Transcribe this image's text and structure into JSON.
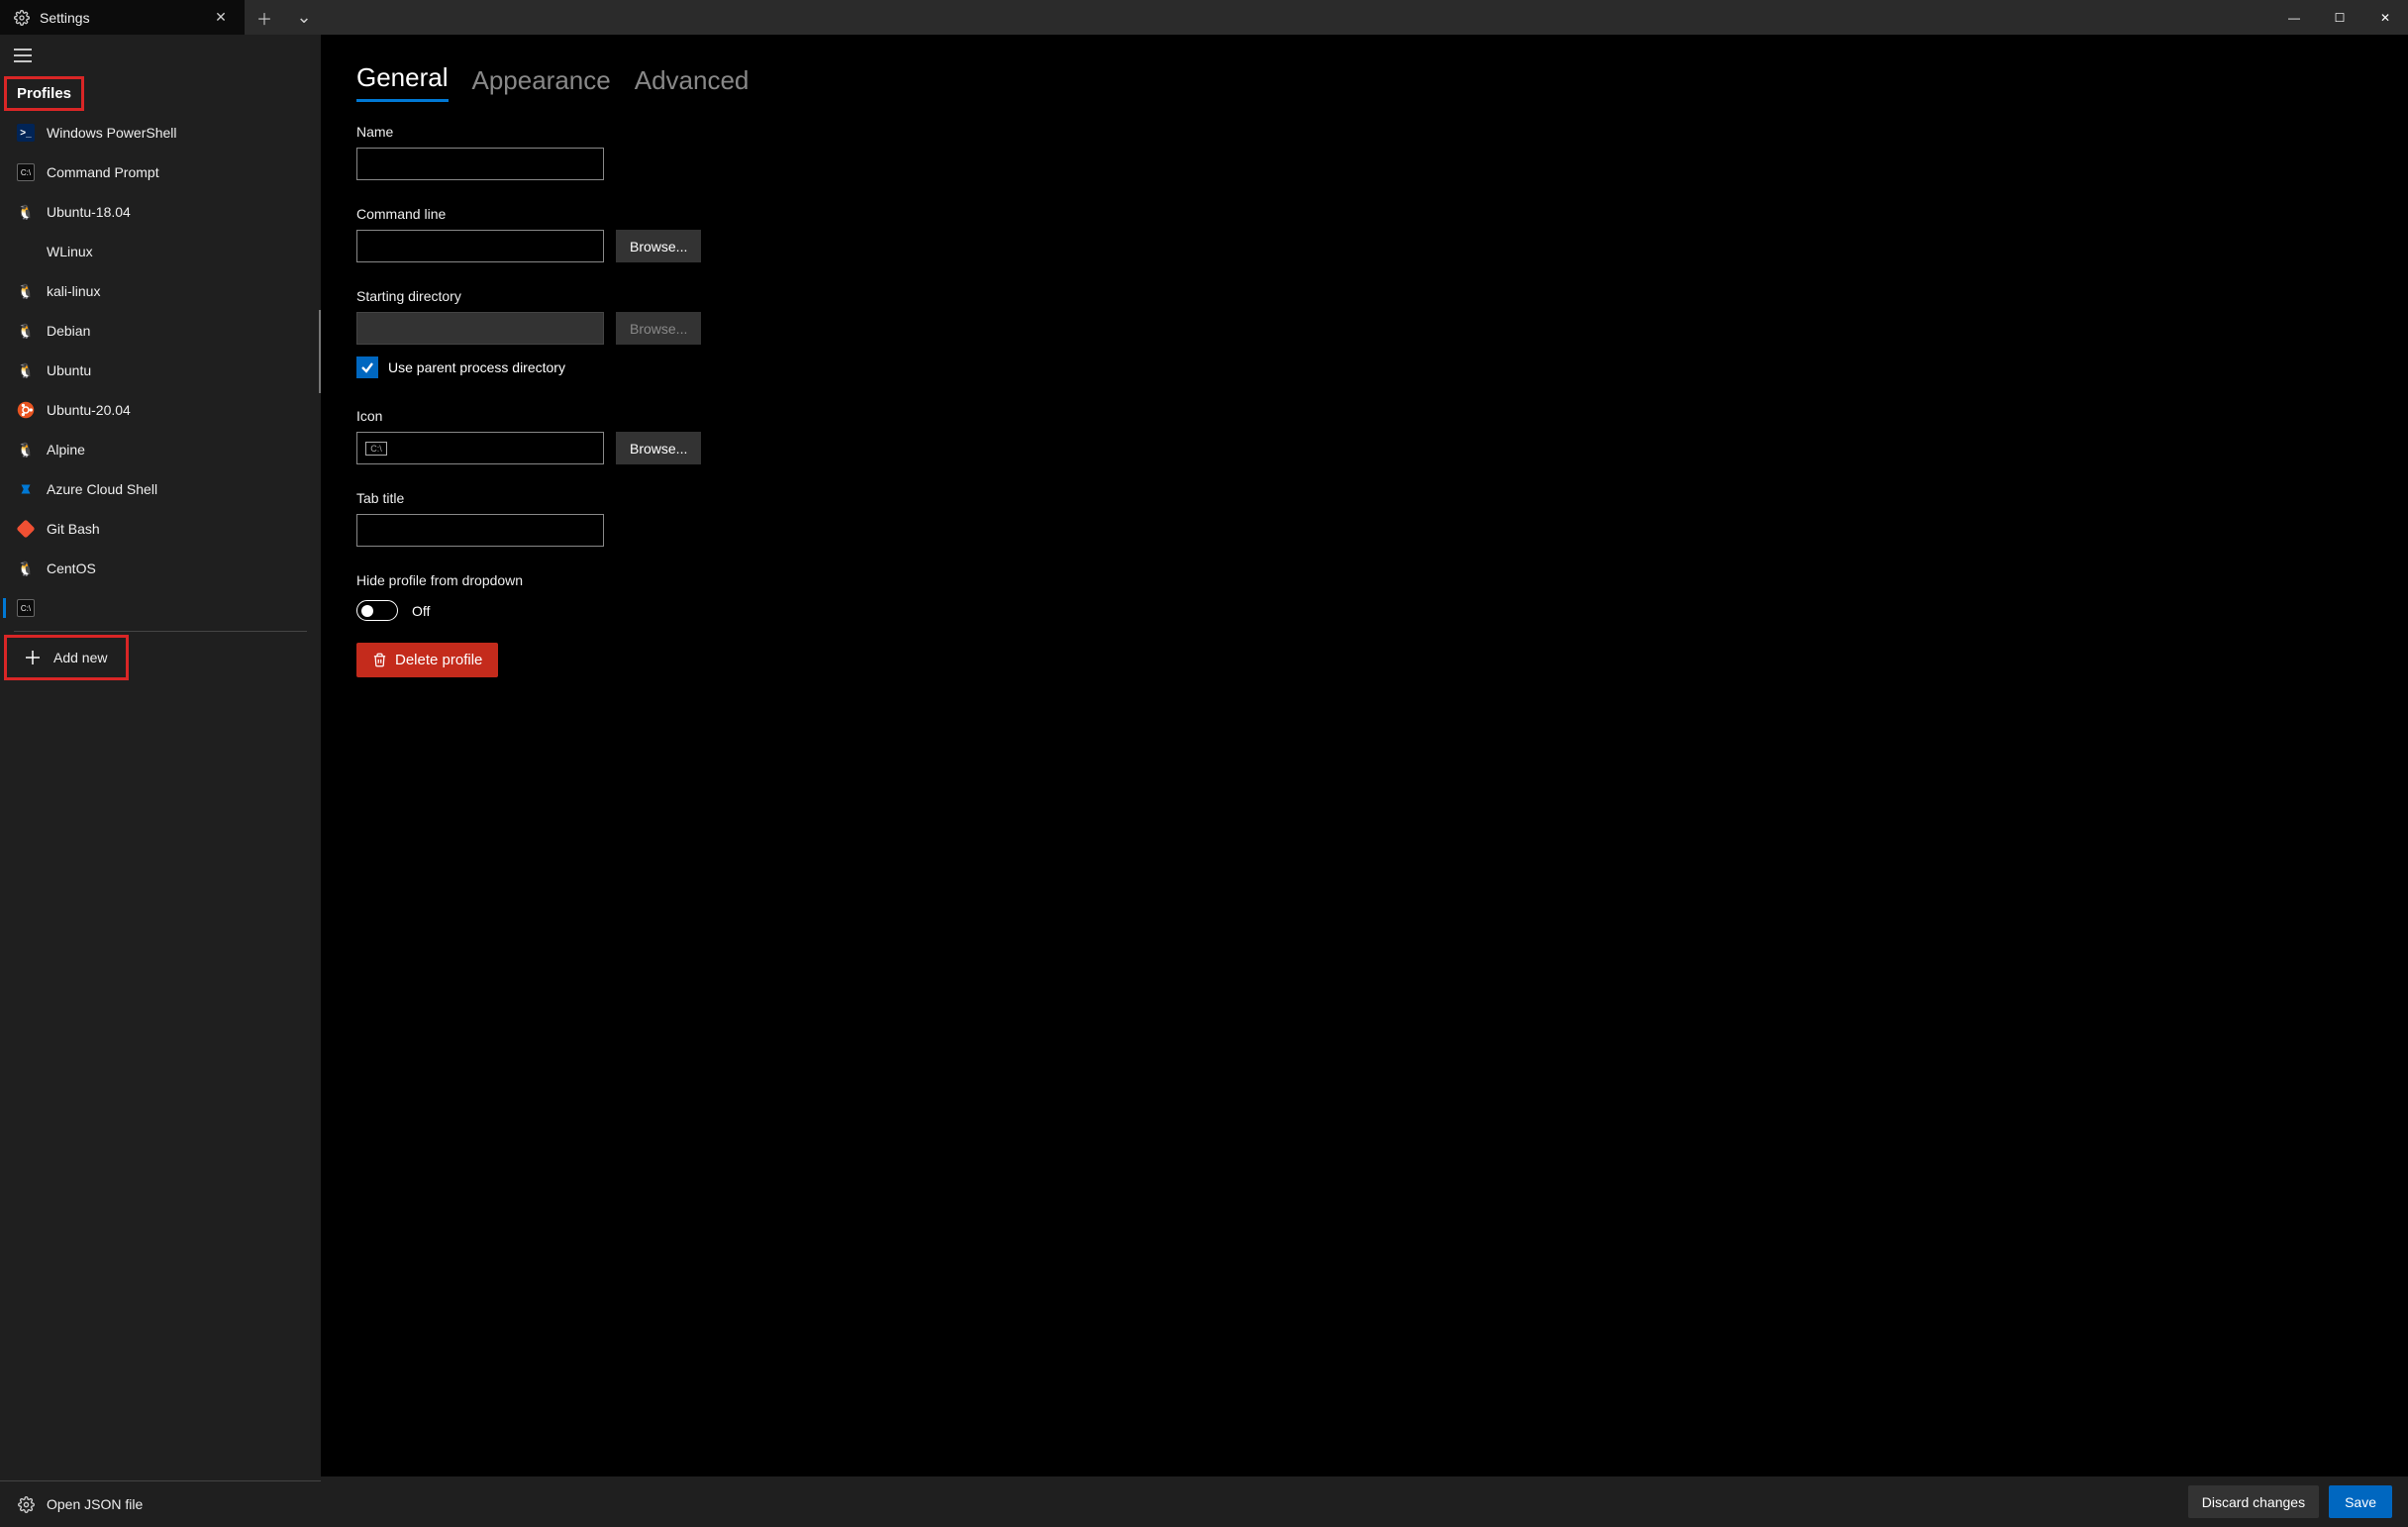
{
  "titlebar": {
    "tab_label": "Settings",
    "close_glyph": "✕",
    "newtab_glyph": "＋",
    "dropdown_glyph": "⌄",
    "min_glyph": "—",
    "max_glyph": "☐",
    "winclose_glyph": "✕"
  },
  "sidebar": {
    "section": "Profiles",
    "items": [
      {
        "label": "Windows PowerShell",
        "icon": "ps"
      },
      {
        "label": "Command Prompt",
        "icon": "cmd"
      },
      {
        "label": "Ubuntu-18.04",
        "icon": "tux"
      },
      {
        "label": "WLinux",
        "icon": ""
      },
      {
        "label": "kali-linux",
        "icon": "tux"
      },
      {
        "label": "Debian",
        "icon": "tux"
      },
      {
        "label": "Ubuntu",
        "icon": "tux"
      },
      {
        "label": "Ubuntu-20.04",
        "icon": "ubuntu"
      },
      {
        "label": "Alpine",
        "icon": "tux"
      },
      {
        "label": "Azure Cloud Shell",
        "icon": "azure"
      },
      {
        "label": "Git Bash",
        "icon": "git"
      },
      {
        "label": "CentOS",
        "icon": "tux"
      }
    ],
    "selected_blank_icon": "⌘",
    "add_new": "Add new",
    "open_json": "Open JSON file"
  },
  "content": {
    "tabs": {
      "general": "General",
      "appearance": "Appearance",
      "advanced": "Advanced"
    },
    "labels": {
      "name": "Name",
      "command_line": "Command line",
      "starting_directory": "Starting directory",
      "use_parent": "Use parent process directory",
      "icon": "Icon",
      "tab_title": "Tab title",
      "hide_profile": "Hide profile from dropdown"
    },
    "values": {
      "name": "",
      "command_line": "",
      "starting_directory": "",
      "icon": "",
      "tab_title": "",
      "hide_profile_state": "Off"
    },
    "buttons": {
      "browse": "Browse...",
      "delete": "Delete profile",
      "discard": "Discard changes",
      "save": "Save"
    }
  }
}
